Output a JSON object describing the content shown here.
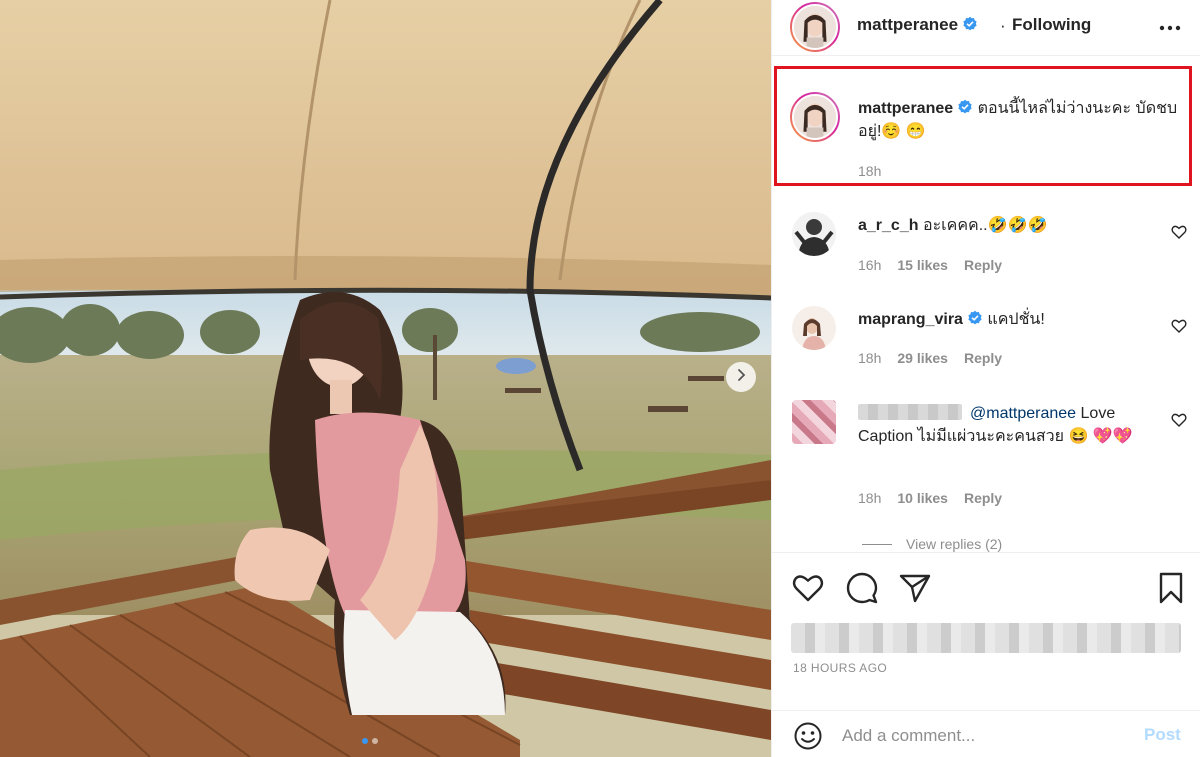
{
  "post": {
    "author": "mattperanee",
    "follow_separator": "·",
    "follow_status": "Following",
    "caption_text": "ตอนนี้ไหล่ไม่ว่างนะคะ บัดชบ อยู่!☺️ 😁",
    "caption_time": "18h",
    "time_ago": "18 HOURS AGO"
  },
  "comments": [
    {
      "user": "a_r_c_h",
      "text": "อะเคคค..🤣🤣🤣",
      "time": "16h",
      "likes": "15 likes",
      "reply": "Reply"
    },
    {
      "user": "maprang_vira",
      "text": "แคปชั่น!",
      "time": "18h",
      "likes": "29 likes",
      "reply": "Reply"
    },
    {
      "user": "",
      "mention": "@mattperanee",
      "text": " Love Caption ไม่มีแผ่วนะคะคนสวย 😆 💖💖",
      "time": "18h",
      "likes": "10 likes",
      "reply": "Reply"
    }
  ],
  "view_replies": "View replies (2)",
  "comment_box": {
    "placeholder": "Add a comment...",
    "post_label": "Post"
  },
  "icons": {
    "more": "more-horizontal-icon",
    "verified": "verified-badge-icon",
    "like": "heart-icon",
    "comment": "comment-bubble-icon",
    "share": "paper-plane-icon",
    "save": "bookmark-icon",
    "emoji": "smiley-icon",
    "next": "chevron-right-icon"
  },
  "colors": {
    "verified": "#3897f0",
    "highlight": "#e0141e",
    "post_disabled": "#b3dbff"
  }
}
